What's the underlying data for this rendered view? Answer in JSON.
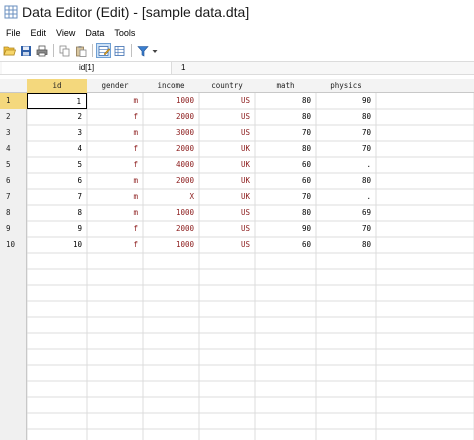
{
  "window": {
    "title": "Data Editor (Edit) - [sample data.dta]"
  },
  "menu": [
    "File",
    "Edit",
    "View",
    "Data",
    "Tools"
  ],
  "toolbar": {
    "icons": [
      "open-folder-icon",
      "save-icon",
      "print-icon",
      "copy-icon",
      "paste-icon",
      "edit-mode-icon",
      "browse-mode-icon",
      "filter-icon",
      "dropdown-arrow-icon"
    ]
  },
  "formula": {
    "cell_ref": "id[1]",
    "cell_value": "1"
  },
  "colors": {
    "selected_header": "#f4d87d",
    "string_value": "#8b1a1a",
    "gridline": "#dcdcdc"
  },
  "table": {
    "columns": [
      "id",
      "gender",
      "income",
      "country",
      "math",
      "physics"
    ],
    "column_types": [
      "num",
      "str",
      "str",
      "str",
      "num",
      "num"
    ],
    "rows": [
      [
        "1",
        "m",
        "1000",
        "US",
        "80",
        "90"
      ],
      [
        "2",
        "f",
        "2000",
        "US",
        "80",
        "80"
      ],
      [
        "3",
        "m",
        "3000",
        "US",
        "70",
        "70"
      ],
      [
        "4",
        "f",
        "2000",
        "UK",
        "80",
        "70"
      ],
      [
        "5",
        "f",
        "4000",
        "UK",
        "60",
        "."
      ],
      [
        "6",
        "m",
        "2000",
        "UK",
        "60",
        "80"
      ],
      [
        "7",
        "m",
        "X",
        "UK",
        "70",
        "."
      ],
      [
        "8",
        "m",
        "1000",
        "US",
        "80",
        "69"
      ],
      [
        "9",
        "f",
        "2000",
        "US",
        "90",
        "70"
      ],
      [
        "10",
        "f",
        "1000",
        "US",
        "60",
        "80"
      ]
    ]
  }
}
